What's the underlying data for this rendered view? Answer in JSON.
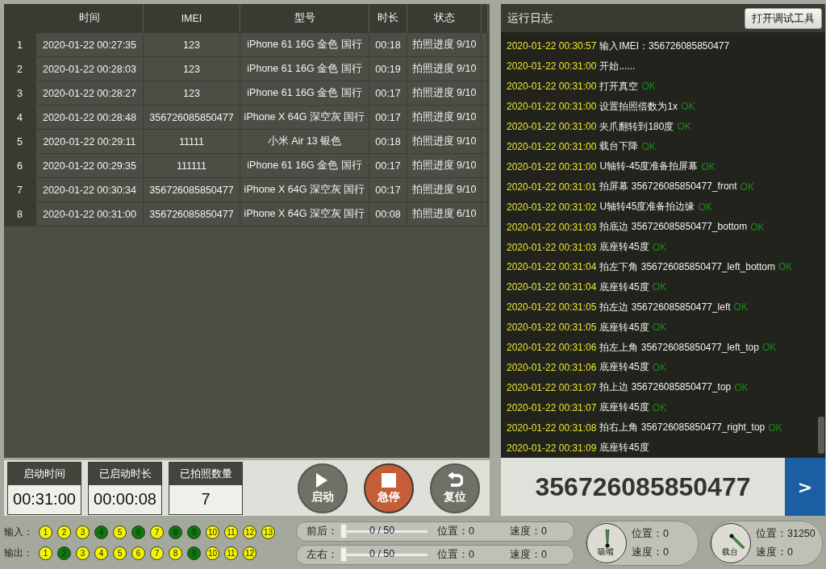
{
  "table": {
    "columns": [
      "时间",
      "IMEI",
      "型号",
      "时长",
      "状态"
    ],
    "rows": [
      {
        "index": "1",
        "cells": [
          "2020-01-22 00:27:35",
          "123",
          "iPhone 61 16G 金色 国行",
          "00:18",
          "拍照进度 9/10"
        ]
      },
      {
        "index": "2",
        "cells": [
          "2020-01-22 00:28:03",
          "123",
          "iPhone 61 16G 金色 国行",
          "00:19",
          "拍照进度 9/10"
        ]
      },
      {
        "index": "3",
        "cells": [
          "2020-01-22 00:28:27",
          "123",
          "iPhone 61 16G 金色 国行",
          "00:17",
          "拍照进度 9/10"
        ]
      },
      {
        "index": "4",
        "cells": [
          "2020-01-22 00:28:48",
          "356726085850477",
          "iPhone X 64G 深空灰 国行",
          "00:17",
          "拍照进度 9/10"
        ]
      },
      {
        "index": "5",
        "cells": [
          "2020-01-22 00:29:11",
          "11111",
          "小米 Air 13  银色",
          "00:18",
          "拍照进度 9/10"
        ]
      },
      {
        "index": "6",
        "cells": [
          "2020-01-22 00:29:35",
          "111111",
          "iPhone 61 16G 金色 国行",
          "00:17",
          "拍照进度 9/10"
        ]
      },
      {
        "index": "7",
        "cells": [
          "2020-01-22 00:30:34",
          "356726085850477",
          "iPhone X 64G 深空灰 国行",
          "00:17",
          "拍照进度 9/10"
        ]
      },
      {
        "index": "8",
        "cells": [
          "2020-01-22 00:31:00",
          "356726085850477",
          "iPhone X 64G 深空灰 国行",
          "00:08",
          "拍照进度 6/10"
        ]
      }
    ]
  },
  "stats": [
    {
      "label": "启动时间",
      "value": "00:31:00"
    },
    {
      "label": "已启动时长",
      "value": "00:00:08"
    },
    {
      "label": "已拍照数量",
      "value": "7"
    }
  ],
  "controls": [
    {
      "kind": "start",
      "label": "启动"
    },
    {
      "kind": "stop",
      "label": "急停"
    },
    {
      "kind": "reset",
      "label": "复位"
    }
  ],
  "log": {
    "title": "运行日志",
    "tool_button": "打开调试工具",
    "entries": [
      {
        "time": "2020-01-22 00:30:57",
        "message": "输入IMEI：356726085850477"
      },
      {
        "time": "2020-01-22 00:31:00",
        "message": "开始......"
      },
      {
        "time": "2020-01-22 00:31:00",
        "message": "打开真空",
        "status": "OK"
      },
      {
        "time": "2020-01-22 00:31:00",
        "message": "设置拍照倍数为1x",
        "status": "OK"
      },
      {
        "time": "2020-01-22 00:31:00",
        "message": "夹爪翻转到180度",
        "status": "OK"
      },
      {
        "time": "2020-01-22 00:31:00",
        "message": "载台下降",
        "status": "OK"
      },
      {
        "time": "2020-01-22 00:31:00",
        "message": "U轴转-45度准备拍屏幕",
        "status": "OK"
      },
      {
        "time": "2020-01-22 00:31:01",
        "message": "拍屏幕 356726085850477_front",
        "status": "OK"
      },
      {
        "time": "2020-01-22 00:31:02",
        "message": "U轴转45度准备拍边缘",
        "status": "OK"
      },
      {
        "time": "2020-01-22 00:31:03",
        "message": "拍底边 356726085850477_bottom",
        "status": "OK"
      },
      {
        "time": "2020-01-22 00:31:03",
        "message": "底座转45度",
        "status": "OK"
      },
      {
        "time": "2020-01-22 00:31:04",
        "message": "拍左下角 356726085850477_left_bottom",
        "status": "OK"
      },
      {
        "time": "2020-01-22 00:31:04",
        "message": "底座转45度",
        "status": "OK"
      },
      {
        "time": "2020-01-22 00:31:05",
        "message": "拍左边 356726085850477_left",
        "status": "OK"
      },
      {
        "time": "2020-01-22 00:31:05",
        "message": "底座转45度",
        "status": "OK"
      },
      {
        "time": "2020-01-22 00:31:06",
        "message": "拍左上角 356726085850477_left_top",
        "status": "OK"
      },
      {
        "time": "2020-01-22 00:31:06",
        "message": "底座转45度",
        "status": "OK"
      },
      {
        "time": "2020-01-22 00:31:07",
        "message": "拍上边 356726085850477_top",
        "status": "OK"
      },
      {
        "time": "2020-01-22 00:31:07",
        "message": "底座转45度",
        "status": "OK"
      },
      {
        "time": "2020-01-22 00:31:08",
        "message": "拍右上角 356726085850477_right_top",
        "status": "OK"
      },
      {
        "time": "2020-01-22 00:31:09",
        "message": "底座转45度"
      }
    ]
  },
  "imei": {
    "value": "356726085850477",
    "go_button": ">"
  },
  "io": [
    {
      "label": "输入：",
      "pins": [
        {
          "n": "1",
          "on": false
        },
        {
          "n": "2",
          "on": false
        },
        {
          "n": "3",
          "on": false
        },
        {
          "n": "4",
          "on": true
        },
        {
          "n": "5",
          "on": false
        },
        {
          "n": "6",
          "on": true
        },
        {
          "n": "7",
          "on": false
        },
        {
          "n": "8",
          "on": true
        },
        {
          "n": "9",
          "on": true
        },
        {
          "n": "10",
          "on": false
        },
        {
          "n": "11",
          "on": false
        },
        {
          "n": "12",
          "on": false
        },
        {
          "n": "13",
          "on": false
        }
      ]
    },
    {
      "label": "输出：",
      "pins": [
        {
          "n": "1",
          "on": false
        },
        {
          "n": "2",
          "on": true
        },
        {
          "n": "3",
          "on": false
        },
        {
          "n": "4",
          "on": false
        },
        {
          "n": "5",
          "on": false
        },
        {
          "n": "6",
          "on": false
        },
        {
          "n": "7",
          "on": false
        },
        {
          "n": "8",
          "on": false
        },
        {
          "n": "9",
          "on": true
        },
        {
          "n": "10",
          "on": false
        },
        {
          "n": "11",
          "on": false
        },
        {
          "n": "12",
          "on": false
        }
      ]
    }
  ],
  "axes": [
    {
      "label": "前后：",
      "level": 0,
      "reading": "0 / 50",
      "position": "位置：0",
      "speed": "速度：0"
    },
    {
      "label": "左右：",
      "level": 0,
      "reading": "0 / 50",
      "position": "位置：0",
      "speed": "速度：0"
    }
  ],
  "dials": [
    {
      "label": "吸嘴",
      "position": "位置：0",
      "speed": "速度：0"
    },
    {
      "label": "载台",
      "position": "位置：31250",
      "speed": "速度：0"
    }
  ]
}
